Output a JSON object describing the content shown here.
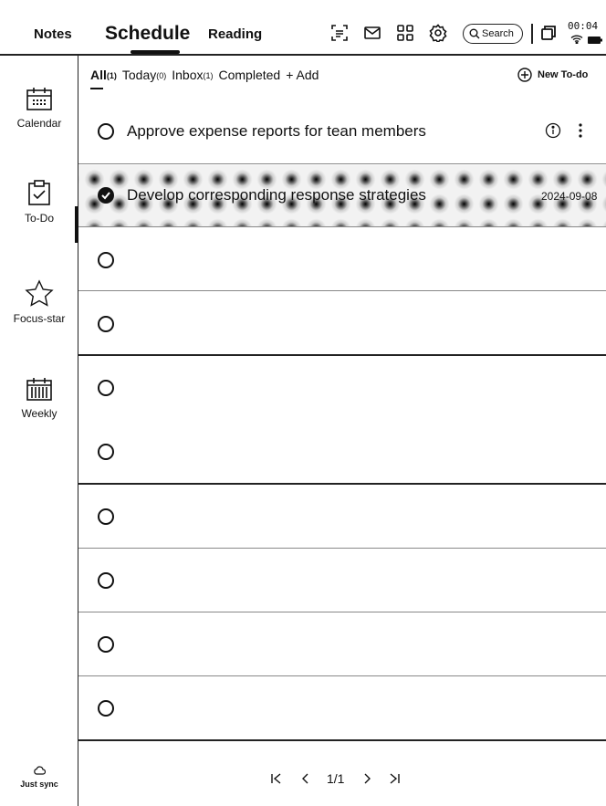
{
  "topbar": {
    "tabs": [
      "Notes",
      "Schedule",
      "Reading"
    ],
    "search_label": "Search",
    "clock": "00:04",
    "icons": [
      "scan-icon",
      "mail-icon",
      "apps-icon",
      "settings-icon",
      "search-icon",
      "window-icon",
      "wifi-icon",
      "battery-icon"
    ]
  },
  "sidebar": {
    "items": [
      {
        "label": "Calendar",
        "icon": "calendar-icon"
      },
      {
        "label": "To-Do",
        "icon": "todo-icon"
      },
      {
        "label": "Focus-star",
        "icon": "star-icon"
      },
      {
        "label": "Weekly",
        "icon": "weekly-icon"
      }
    ],
    "sync_label": "Just sync"
  },
  "filters": {
    "all": "All",
    "all_count": "(1)",
    "today": "Today",
    "today_count": "(0)",
    "inbox": "Inbox",
    "inbox_count": "(1)",
    "completed": "Completed",
    "add": "+ Add",
    "new_todo": "New To-do"
  },
  "tasks": [
    {
      "title": "Approve expense reports for tean members",
      "done": false
    },
    {
      "title": "Develop corresponding response strategies",
      "done": true,
      "date": "2024-09-08"
    }
  ],
  "pager": {
    "page": "1/1"
  }
}
